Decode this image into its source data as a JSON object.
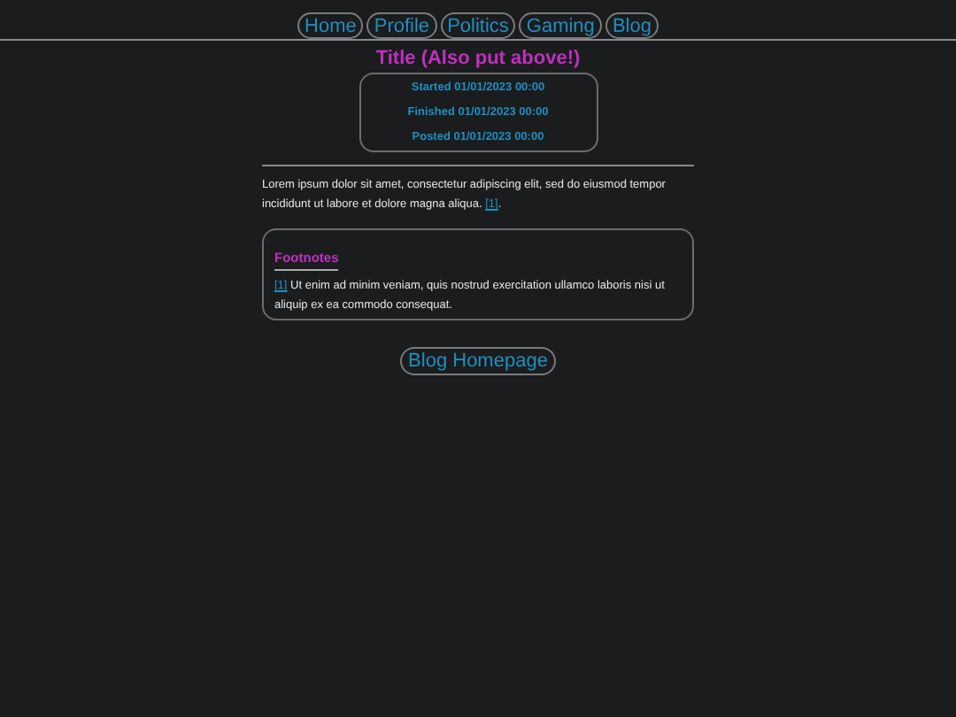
{
  "nav": [
    {
      "label": "Home"
    },
    {
      "label": "Profile"
    },
    {
      "label": "Politics"
    },
    {
      "label": "Gaming"
    },
    {
      "label": "Blog"
    }
  ],
  "title": "Title (Also put above!)",
  "meta": [
    "Started 01/01/2023 00:00",
    "Finished 01/01/2023 00:00",
    "Posted 01/01/2023 00:00"
  ],
  "body": {
    "text": "Lorem ipsum dolor sit amet, consectetur adipiscing elit, sed do eiusmod tempor incididunt ut labore et dolore magna aliqua.",
    "ref": "[1]",
    "end": "."
  },
  "footnotes": {
    "heading": "Footnotes",
    "items": [
      {
        "ref": "[1]",
        "text": "Ut enim ad minim veniam, quis nostrud exercitation ullamco laboris nisi ut aliquip ex ea commodo consequat."
      }
    ]
  },
  "home_button": "Blog Homepage"
}
